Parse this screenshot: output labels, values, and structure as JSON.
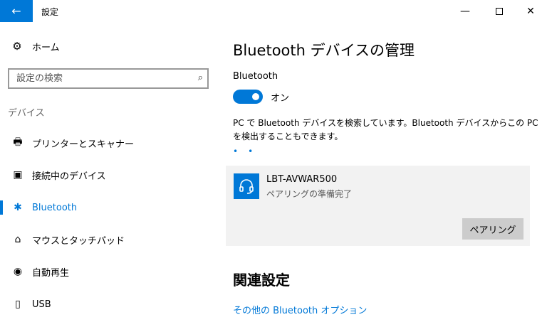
{
  "window": {
    "title": "設定",
    "back_icon": "←",
    "minimize_icon": "—",
    "close_icon": "✕"
  },
  "sidebar": {
    "home": {
      "icon": "⚙",
      "label": "ホーム"
    },
    "search": {
      "placeholder": "設定の検索",
      "icon": "⌕"
    },
    "section_label": "デバイス",
    "items": [
      {
        "icon": "🖶",
        "label": "プリンターとスキャナー"
      },
      {
        "icon": "▣",
        "label": "接続中のデバイス"
      },
      {
        "icon": "✱",
        "label": "Bluetooth",
        "active": true
      },
      {
        "icon": "⌂",
        "label": "マウスとタッチパッド"
      },
      {
        "icon": "◉",
        "label": "自動再生"
      },
      {
        "icon": "▯",
        "label": "USB"
      }
    ]
  },
  "main": {
    "title": "Bluetooth デバイスの管理",
    "bluetooth_label": "Bluetooth",
    "toggle": {
      "on": true,
      "state_label": "オン",
      "color": "#0078d7"
    },
    "description": "PC で Bluetooth デバイスを検索しています。Bluetooth デバイスからこの PC を検出することもできます。",
    "searching_dots": "••",
    "device": {
      "icon": "headset-icon",
      "name": "LBT-AVWAR500",
      "status": "ペアリングの準備完了",
      "pair_button": "ペアリング"
    },
    "related_title": "関連設定",
    "related_link": "その他の Bluetooth オプション"
  },
  "colors": {
    "accent": "#0078d7",
    "panel_bg": "#f2f2f2",
    "button_bg": "#cccccc"
  }
}
